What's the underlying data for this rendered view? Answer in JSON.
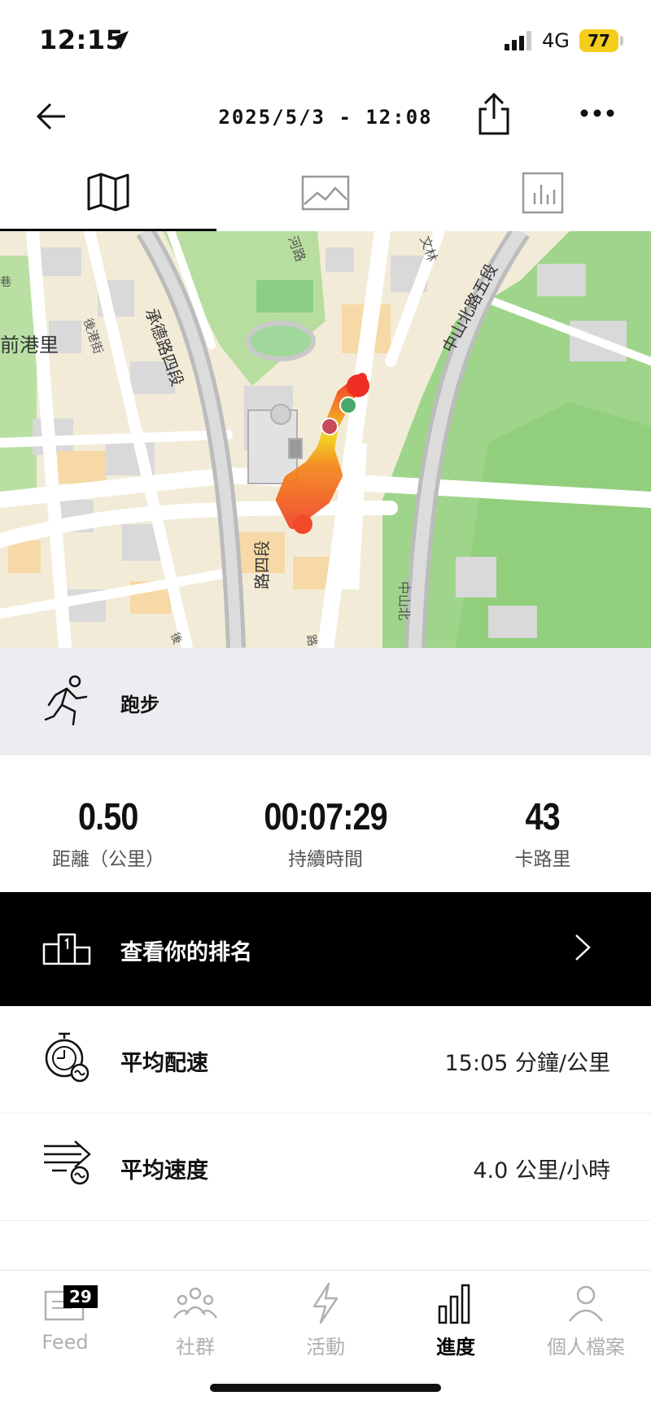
{
  "status_bar": {
    "time": "12:15",
    "network": "4G",
    "battery": "77"
  },
  "header": {
    "title": "2025/5/3 - 12:08"
  },
  "map": {
    "labels": {
      "area_left": "前港里",
      "road_chengde": "承德路四段",
      "road_chengde_bottom": "路四段",
      "road_zhongshan": "中山北路五段",
      "road_zhongshan_bottom": "中山北",
      "lane_hougang": "後港街",
      "lane_top": "河路",
      "lane_top_right": "文林",
      "lane_left_edge": "巷",
      "lane_bottom": "後",
      "lane_bottom_mid": "路"
    }
  },
  "activity": {
    "type_label": "跑步"
  },
  "stats": {
    "distance": {
      "value": "0.50",
      "label": "距離（公里）"
    },
    "duration": {
      "value": "00:07:29",
      "label": "持續時間"
    },
    "calories": {
      "value": "43",
      "label": "卡路里"
    }
  },
  "ranking": {
    "label": "查看你的排名"
  },
  "metrics": [
    {
      "label": "平均配速",
      "value": "15:05 分鐘/公里"
    },
    {
      "label": "平均速度",
      "value": "4.0 公里/小時"
    }
  ],
  "nav": {
    "items": [
      {
        "label": "Feed",
        "badge": "29"
      },
      {
        "label": "社群"
      },
      {
        "label": "活動"
      },
      {
        "label": "進度"
      },
      {
        "label": "個人檔案"
      }
    ],
    "active": "進度"
  },
  "colors": {
    "accent": "#000000",
    "battery": "#f4cc1a",
    "route_start": "#4aa86a",
    "route_end": "#d14545",
    "park": "#a7d98f"
  }
}
